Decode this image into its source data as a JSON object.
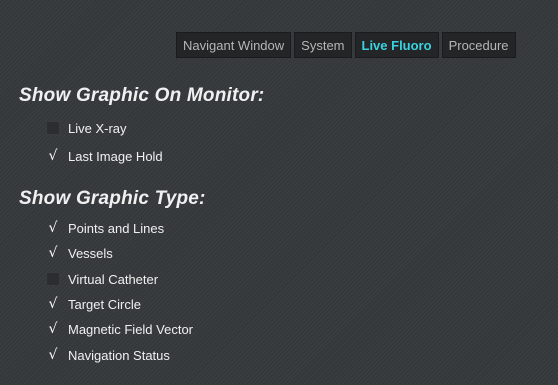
{
  "tabs": [
    {
      "label": "Navigant Window",
      "active": false
    },
    {
      "label": "System",
      "active": false
    },
    {
      "label": "Live Fluoro",
      "active": true
    },
    {
      "label": "Procedure",
      "active": false
    }
  ],
  "monitor_section": {
    "title": "Show Graphic On Monitor:",
    "options": [
      {
        "label": "Live X-ray",
        "checked": false
      },
      {
        "label": "Last Image Hold",
        "checked": true
      }
    ]
  },
  "type_section": {
    "title": "Show Graphic Type:",
    "options": [
      {
        "label": "Points and Lines",
        "checked": true
      },
      {
        "label": "Vessels",
        "checked": true
      },
      {
        "label": "Virtual Catheter",
        "checked": false
      },
      {
        "label": "Target Circle",
        "checked": true
      },
      {
        "label": "Magnetic Field Vector",
        "checked": true
      },
      {
        "label": "Navigation Status",
        "checked": true
      }
    ]
  },
  "check_glyph": "√",
  "colors": {
    "active_tab": "#3ad1e0",
    "background": "#35383b"
  }
}
